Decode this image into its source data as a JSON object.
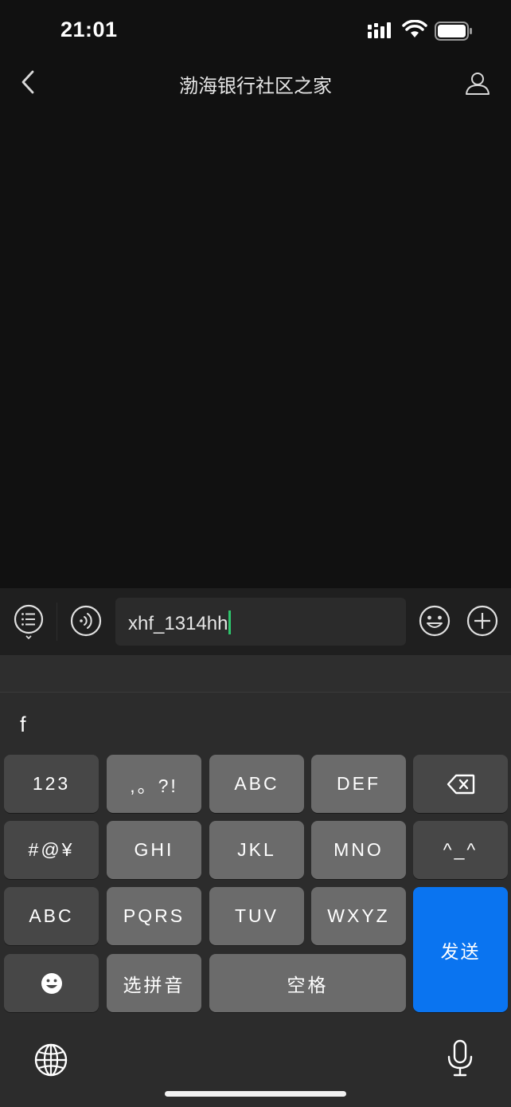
{
  "status_bar": {
    "time": "21:01"
  },
  "nav": {
    "title": "渤海银行社区之家"
  },
  "input": {
    "value": "xhf_1314hh"
  },
  "keyboard": {
    "candidate": "f",
    "keys": {
      "k123": "123",
      "punct": ",。?!",
      "abc": "ABC",
      "def": "DEF",
      "symbols": "#@¥",
      "ghi": "GHI",
      "jkl": "JKL",
      "mno": "MNO",
      "kaomoji": "^_^",
      "abc_switch": "ABC",
      "pqrs": "PQRS",
      "tuv": "TUV",
      "wxyz": "WXYZ",
      "send": "发送",
      "pinyin": "选拼音",
      "space": "空格"
    }
  },
  "colors": {
    "background": "#111111",
    "key": "#6b6b6b",
    "key_dark": "#474747",
    "send": "#0a74f0",
    "caret": "#2ec46c"
  },
  "icons": [
    "back-chevron-icon",
    "profile-icon",
    "list-menu-icon",
    "voice-icon",
    "emoji-icon",
    "plus-icon",
    "backspace-icon",
    "smiley-icon",
    "globe-icon",
    "microphone-icon"
  ]
}
